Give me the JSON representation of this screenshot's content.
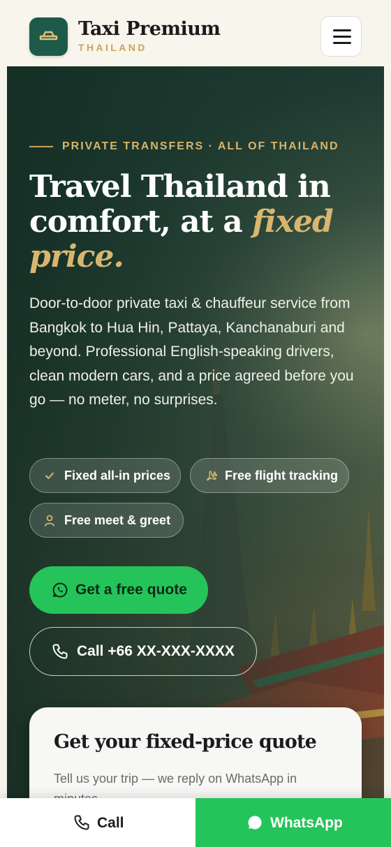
{
  "header": {
    "brand_name": "Taxi Premium",
    "brand_sub": "THAILAND"
  },
  "hero": {
    "eyebrow": "PRIVATE TRANSFERS · ALL OF THAILAND",
    "headline_part1": "Travel Thailand in comfort, at a ",
    "headline_em": "fixed price.",
    "lead": "Door-to-door private taxi & chauffeur service from Bangkok to Hua Hin, Pattaya, Kanchanaburi and beyond. Professional English-speaking drivers, clean modern cars, and a price agreed before you go — no meter, no surprises.",
    "chips": [
      {
        "label": "Fixed all-in prices",
        "icon": "check-icon"
      },
      {
        "label": "Free flight tracking",
        "icon": "plane-icon"
      },
      {
        "label": "Free meet & greet",
        "icon": "person-icon"
      }
    ],
    "cta_quote": "Get a free quote",
    "cta_call": "Call +66 XX-XXX-XXXX"
  },
  "quote_card": {
    "title": "Get your fixed-price quote",
    "subtitle": "Tell us your trip — we reply on WhatsApp in minutes."
  },
  "bottom_bar": {
    "call_label": "Call",
    "whatsapp_label": "WhatsApp"
  },
  "colors": {
    "accent_gold": "#c9a45a",
    "brand_green": "#1d5a4a",
    "whatsapp_green": "#25c45a"
  }
}
